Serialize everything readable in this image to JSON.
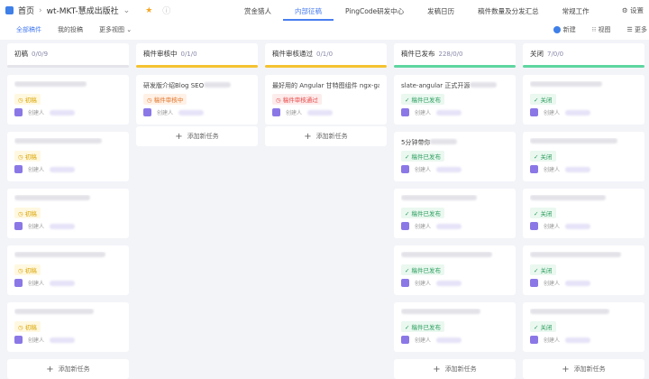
{
  "breadcrumb": {
    "home": "首页",
    "project": "wt-MKT-慧成出版社"
  },
  "nav": [
    "赏金猎人",
    "内部征稿",
    "PingCode研发中心",
    "发稿日历",
    "稿件数量及分发汇总",
    "常规工作"
  ],
  "settings": "设置",
  "views": [
    "全部稿件",
    "我的投稿",
    "更多视图 ⌄"
  ],
  "actions": {
    "new": "新建",
    "view": "视图",
    "more": "更多"
  },
  "add_label": "添加新任务",
  "owner_label": "创建人",
  "columns": [
    {
      "name": "初稿",
      "count": "0/0/9",
      "bar": "#e4e4ea",
      "tag": "初稿",
      "tagColor": "#d9a400",
      "tagBg": "#fff8e1",
      "icon": "◷",
      "cards": [
        "",
        "",
        "",
        "",
        ""
      ]
    },
    {
      "name": "稿件审核中",
      "count": "0/1/0",
      "bar": "#f5c330",
      "tag": "稿件审核中",
      "tagColor": "#e0762b",
      "tagBg": "#fff1e6",
      "icon": "◷",
      "cards": [
        "研发版介绍Blog SEO"
      ]
    },
    {
      "name": "稿件审核通过",
      "count": "0/1/0",
      "bar": "#f5c330",
      "tag": "稿件审核通过",
      "tagColor": "#e84a4a",
      "tagBg": "#fdecec",
      "icon": "◷",
      "cards": [
        "最好用的 Angular 甘特图组件 ngx-gantt"
      ]
    },
    {
      "name": "稿件已发布",
      "count": "228/0/0",
      "bar": "#5ed6a0",
      "tag": "稿件已发布",
      "tagColor": "#2a9d5c",
      "tagBg": "#eaf8f0",
      "icon": "✓",
      "cards": [
        "slate-angular 正式开源",
        "5分钟带你",
        "",
        "",
        ""
      ]
    },
    {
      "name": "关闭",
      "count": "7/0/0",
      "bar": "#5ed6a0",
      "tag": "关闭",
      "tagColor": "#2a9d5c",
      "tagBg": "#eaf8f0",
      "icon": "✓",
      "cards": [
        "",
        "",
        "",
        "",
        ""
      ]
    }
  ]
}
